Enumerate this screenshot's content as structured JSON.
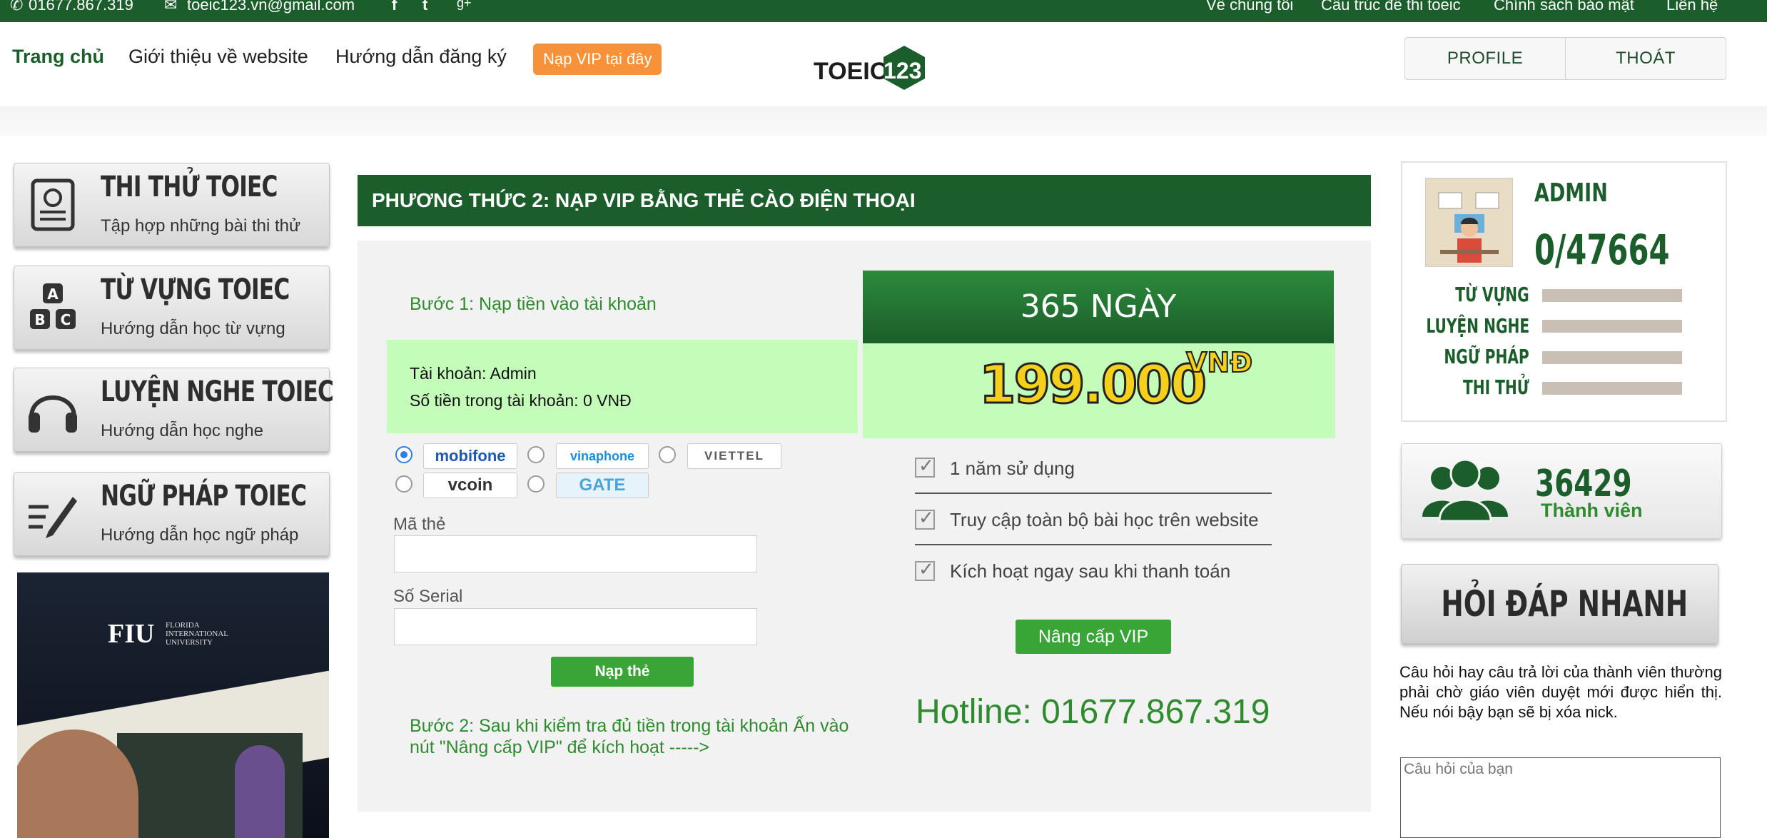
{
  "topbar": {
    "phone": "01677.867.319",
    "email": "toeic123.vn@gmail.com",
    "social": [
      "f",
      "t",
      "g+"
    ],
    "links": [
      "Về chúng tôi",
      "Cấu trúc đề thi toeic",
      "Chính sách bảo mật",
      "Liên hệ"
    ]
  },
  "nav": {
    "home": "Trang chủ",
    "about": "Giới thiệu về website",
    "guide": "Hướng dẫn đăng ký",
    "vip": "Nạp VIP tại đây",
    "logo_a": "TOEIC",
    "logo_b": "123",
    "profile": "PROFILE",
    "logout": "THOÁT"
  },
  "sidebar": {
    "items": [
      {
        "title": "THI THỬ TOIEC",
        "sub": "Tập hợp những bài thi thử",
        "icon": "exam-icon"
      },
      {
        "title": "TỪ VỰNG TOIEC",
        "sub": "Hướng dẫn học từ vựng",
        "icon": "abc-icon"
      },
      {
        "title": "LUYỆN NGHE TOIEC",
        "sub": "Hướng dẫn học nghe",
        "icon": "headphones-icon"
      },
      {
        "title": "NGỮ PHÁP TOIEC",
        "sub": "Hướng dẫn học ngữ pháp",
        "icon": "pencil-icon"
      }
    ],
    "ad": {
      "brand": "FIU",
      "university": [
        "FLORIDA",
        "INTERNATIONAL",
        "UNIVERSITY"
      ]
    }
  },
  "main": {
    "heading": "PHƯƠNG THỨC 2: NẠP VIP BẰNG THẺ CÀO ĐIỆN THOẠI",
    "step1": "Bước 1: Nạp tiền vào tài khoản",
    "account": "Tài khoản: Admin",
    "balance": "Số tiền trong tài khoản: 0 VNĐ",
    "carriers": [
      "mobifone",
      "vinaphone",
      "VIETTEL",
      "vcoin",
      "GATE"
    ],
    "card_label": "Mã thẻ",
    "serial_label": "Số Serial",
    "submit": "Nạp thẻ",
    "step2": "Bước 2: Sau khi kiểm tra đủ tiền trong tài khoản Ấn vào nút \"Nâng cấp VIP\" để kích hoạt ----->",
    "plan": {
      "duration": "365 NGÀY",
      "price": "199.000",
      "currency": "VNĐ",
      "features": [
        "1 năm sử dụng",
        "Truy cập toàn bộ bài học trên website",
        "Kích hoạt ngay sau khi thanh toán"
      ],
      "upgrade": "Nâng cấp VIP",
      "hotline": "Hotline: 01677.867.319"
    }
  },
  "profile": {
    "name": "ADMIN",
    "score": "0/47664",
    "stats": [
      "TỪ VỰNG",
      "LUYỆN NGHE",
      "NGỮ PHÁP",
      "THI THỬ"
    ]
  },
  "members": {
    "count": "36429",
    "label": "Thành viên"
  },
  "faq": {
    "button": "HỎI ĐÁP NHANH",
    "note": "Câu hỏi hay câu trả lời của thành viên thường phải chờ giáo viên duyệt mới được hiển thị. Nếu nói bậy bạn sẽ bị xóa nick.",
    "placeholder": "Câu hỏi của bạn"
  },
  "colors": {
    "brand_green": "#1b5e2b",
    "accent_orange": "#f7923a",
    "button_green": "#3aa537",
    "price_yellow": "#f4d01c",
    "light_green": "#c4fcba"
  }
}
